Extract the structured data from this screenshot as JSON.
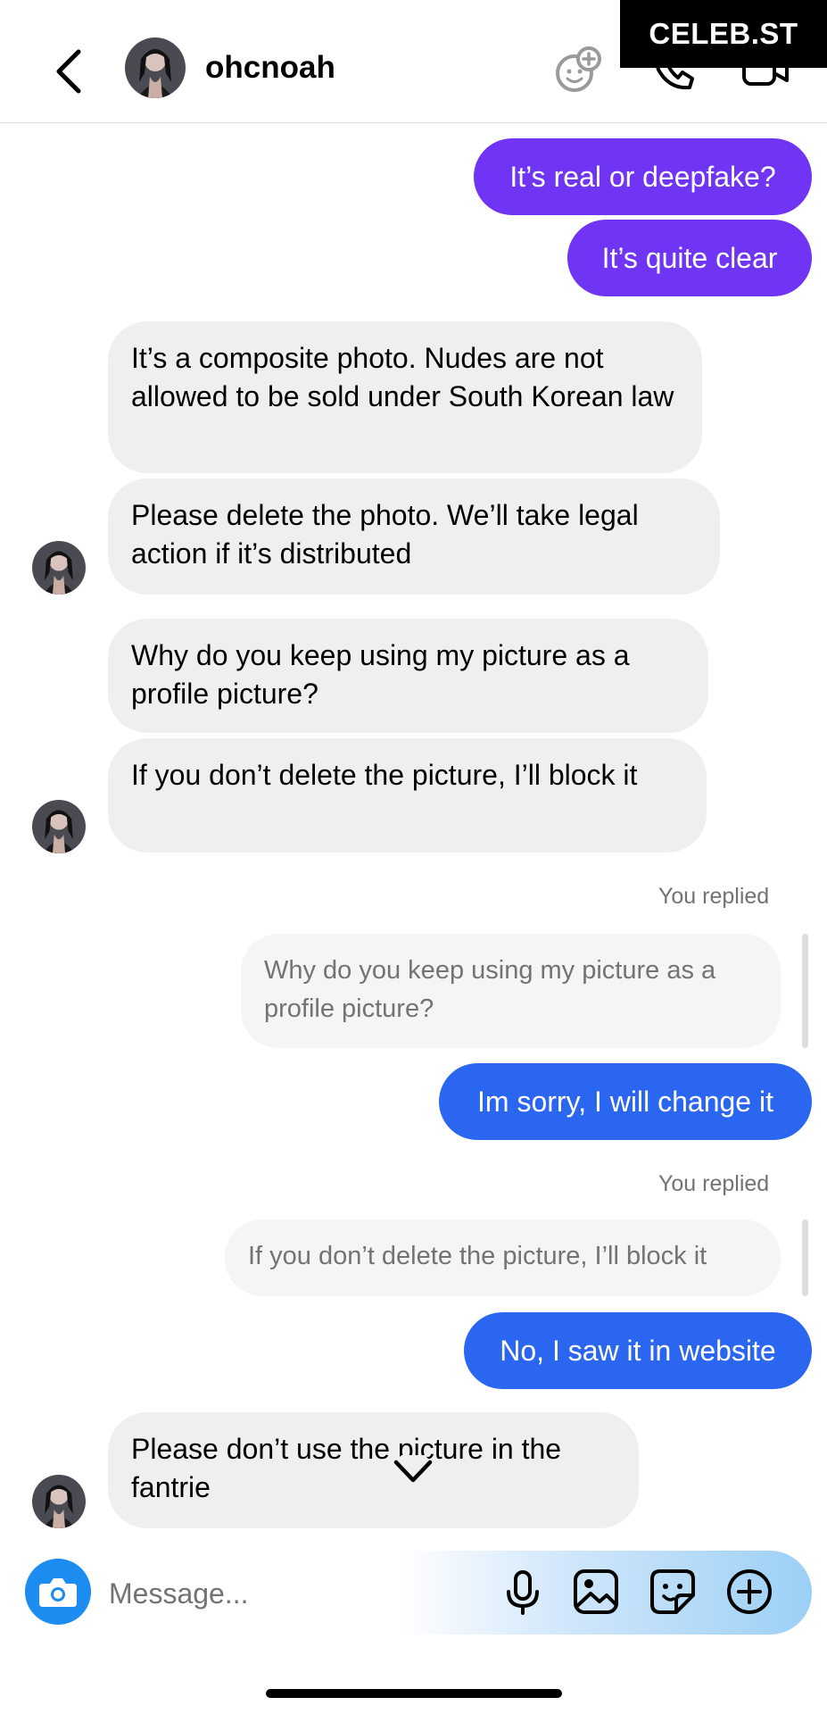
{
  "header": {
    "username": "ohcnoah",
    "watermark": "CELEB.ST"
  },
  "messages": [
    {
      "side": "outgoing",
      "color": "#7034f4",
      "text": "It’s real or deepfake?"
    },
    {
      "side": "outgoing",
      "color": "#7034f4",
      "text": "It’s quite clear"
    },
    {
      "side": "incoming",
      "text": "It’s a composite photo. Nudes are not allowed to be sold under South Korean law"
    },
    {
      "side": "incoming",
      "text": "Please delete the photo. We’ll take legal action if it’s distributed"
    },
    {
      "side": "incoming",
      "text": "Why do you keep using my picture as a profile picture?"
    },
    {
      "side": "incoming",
      "text": "If you don’t delete the picture, I’ll block it"
    },
    {
      "side": "outgoing",
      "color": "#2b66f0",
      "reply_label": "You replied",
      "quoted": "Why do you keep using my picture as a profile picture?",
      "text": "Im sorry, I will change it"
    },
    {
      "side": "outgoing",
      "color": "#2b66f0",
      "reply_label": "You replied",
      "quoted": "If you don’t delete the picture, I’ll block it",
      "text": "No, I saw it in website"
    },
    {
      "side": "incoming",
      "text": "Please don’t use the picture in the fantrie"
    }
  ],
  "composer": {
    "placeholder": "Message..."
  },
  "icons": [
    "back-chevron-icon",
    "effects-icon",
    "phone-icon",
    "video-icon",
    "camera-icon",
    "microphone-icon",
    "gallery-icon",
    "sticker-icon",
    "plus-icon",
    "chevron-down-icon"
  ]
}
